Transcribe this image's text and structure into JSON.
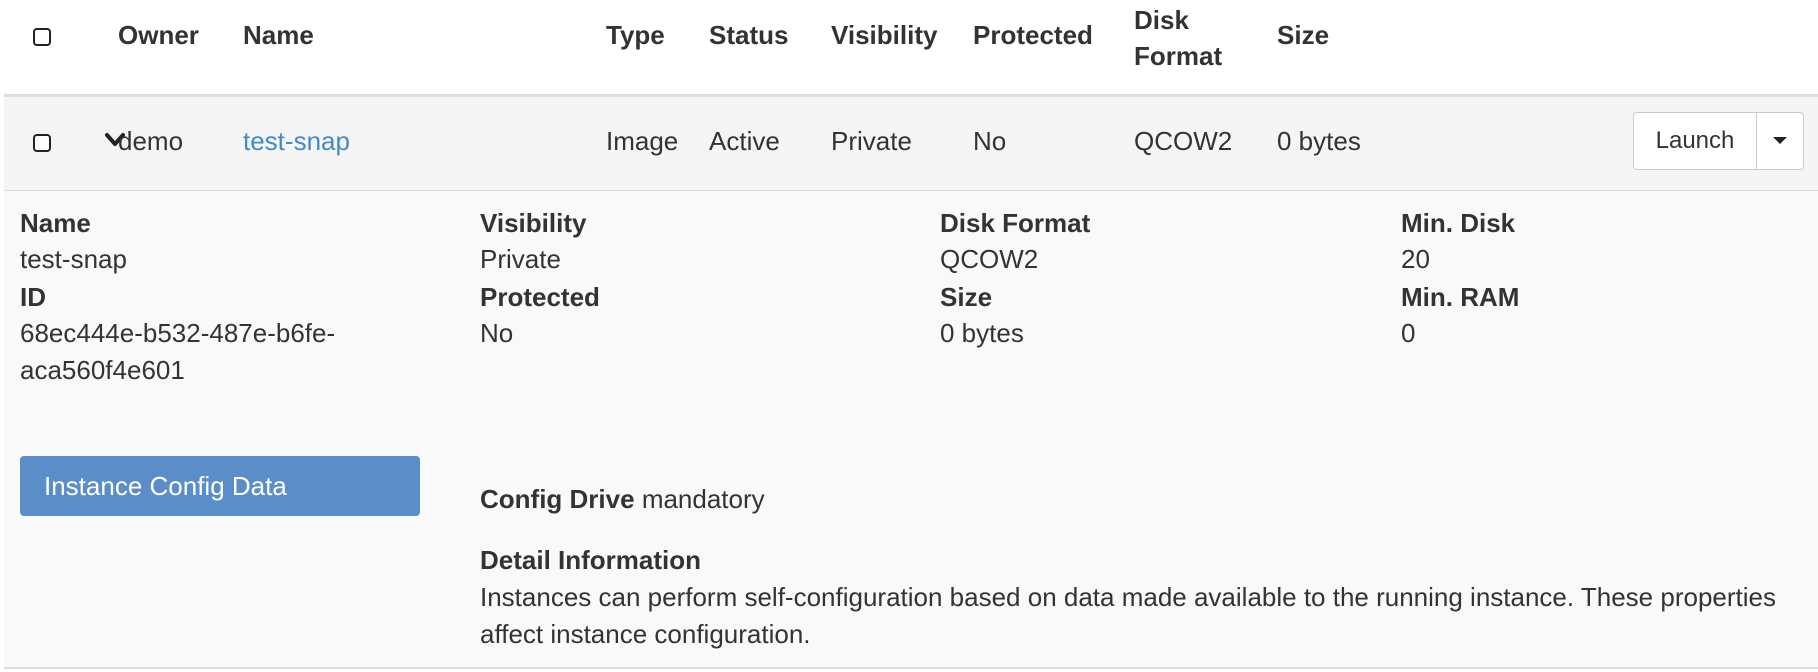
{
  "table": {
    "headers": {
      "owner": "Owner",
      "name": "Name",
      "type": "Type",
      "status": "Status",
      "visibility": "Visibility",
      "protected": "Protected",
      "disk_format_line1": "Disk",
      "disk_format_line2": "Format",
      "size": "Size"
    },
    "row": {
      "owner": "demo",
      "name": "test-snap",
      "type": "Image",
      "status": "Active",
      "visibility": "Private",
      "protected": "No",
      "disk_format": "QCOW2",
      "size": "0 bytes",
      "launch_label": "Launch"
    }
  },
  "details": {
    "name_label": "Name",
    "name_value": "test-snap",
    "id_label": "ID",
    "id_value_line1": "68ec444e-b532-487e-b6fe-",
    "id_value_line2": "aca560f4e601",
    "visibility_label": "Visibility",
    "visibility_value": "Private",
    "protected_label": "Protected",
    "protected_value": "No",
    "disk_format_label": "Disk Format",
    "disk_format_value": "QCOW2",
    "size_label": "Size",
    "size_value": "0 bytes",
    "min_disk_label": "Min. Disk",
    "min_disk_value": "20",
    "min_ram_label": "Min. RAM",
    "min_ram_value": "0",
    "config_button_label": "Instance Config Data",
    "config_drive_label": "Config Drive",
    "config_drive_value": "mandatory",
    "detail_info_title": "Detail Information",
    "detail_info_text": "Instances can perform self-configuration based on data made available to the running instance. These properties affect instance configuration."
  },
  "colors": {
    "link": "#428bca",
    "config_button_bg": "#5b8ec9",
    "row_bg": "#f5f5f5",
    "detail_bg": "#f9f9f9"
  },
  "icons": {
    "expand": "chevron-down-icon",
    "dropdown": "caret-down-icon"
  }
}
